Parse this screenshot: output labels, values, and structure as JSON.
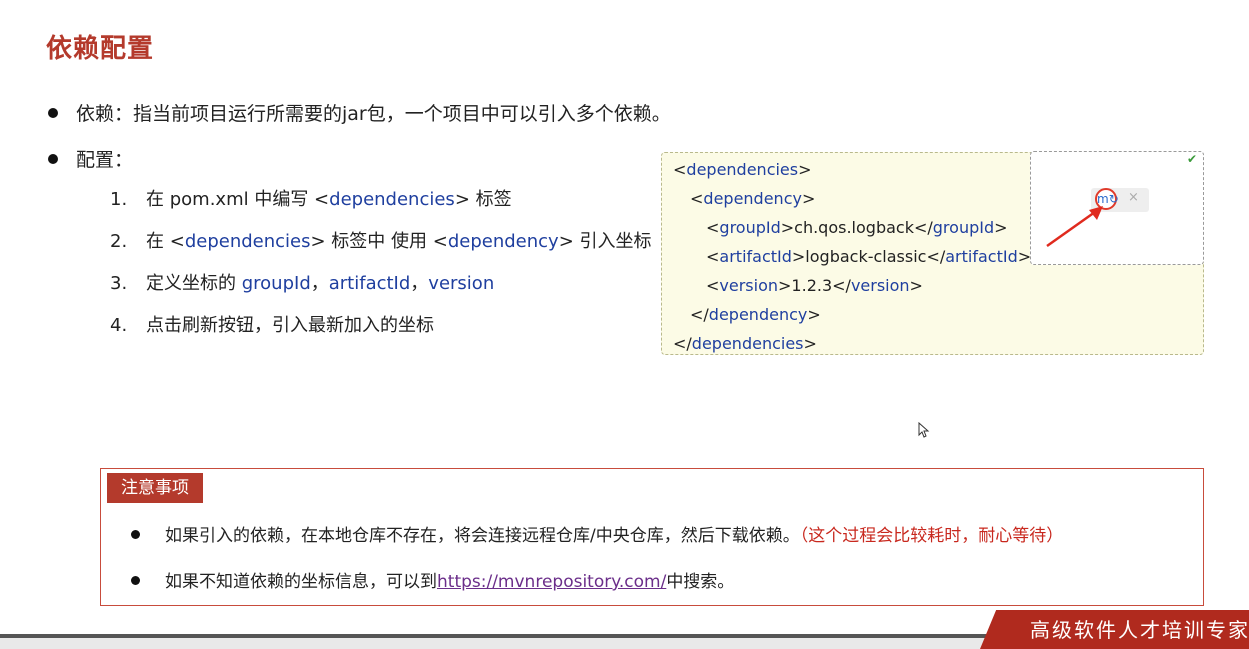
{
  "slide": {
    "title": "依赖配置",
    "bullet1": "依赖：指当前项目运行所需要的jar包，一个项目中可以引入多个依赖。",
    "bullet2": "配置：",
    "steps": [
      {
        "num": "1.",
        "parts": [
          "在 pom.xml 中编写 <",
          "dependencies",
          "> 标签"
        ]
      },
      {
        "num": "2.",
        "parts": [
          "在 <",
          "dependencies",
          "> 标签中 使用 <",
          "dependency",
          "> 引入坐标"
        ]
      },
      {
        "num": "3.",
        "parts": [
          "定义坐标的 ",
          "groupId",
          "，",
          "artifactId",
          "，",
          "version"
        ]
      },
      {
        "num": "4.",
        "parts": [
          "点击刷新按钮，引入最新加入的坐标"
        ]
      }
    ]
  },
  "code": {
    "l1_open": "<",
    "l1_tag": "dependencies",
    "l1_close": ">",
    "l2_open": "<",
    "l2_tag": "dependency",
    "l2_close": ">",
    "l3_tag": "groupId",
    "l3_val": "ch.qos.logback",
    "l4_tag": "artifactId",
    "l4_val": "logback-classic",
    "l5_tag": "version",
    "l5_val": "1.2.3",
    "l6_tag": "dependency",
    "l7_tag": "dependencies"
  },
  "popup": {
    "check_icon": "✔",
    "refresh_icon": "m↻",
    "close_icon": "×"
  },
  "notice": {
    "label": "注意事项",
    "item1_text": "如果引入的依赖，在本地仓库不存在，将会连接远程仓库/中央仓库，然后下载依赖。",
    "item1_highlight": "（这个过程会比较耗时，耐心等待）",
    "item2_pre": "如果不知道依赖的坐标信息，可以到",
    "item2_link": "https://mvnrepository.com/",
    "item2_post": "中搜索。"
  },
  "banner": {
    "text": "高级软件人才培训专家"
  },
  "colors": {
    "accent": "#b43a2c",
    "tag_blue": "#1f3f9f",
    "highlight_red": "#c8281e",
    "link_purple": "#6b2e8a",
    "code_bg": "#fcfbe6"
  }
}
